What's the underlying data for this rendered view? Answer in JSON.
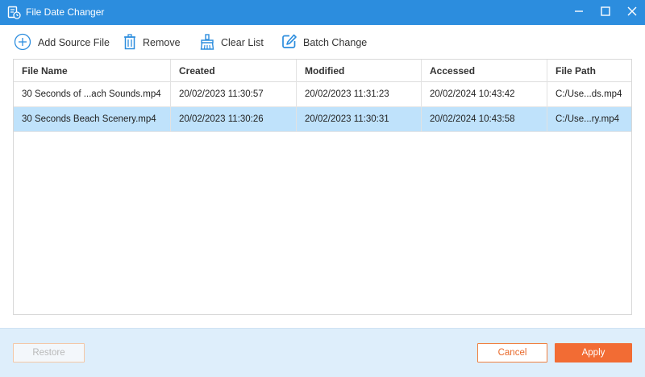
{
  "window": {
    "title": "File Date Changer",
    "accent_color": "#2c8dde"
  },
  "toolbar": {
    "add_label": "Add Source File",
    "remove_label": "Remove",
    "clear_label": "Clear List",
    "batch_label": "Batch Change"
  },
  "table": {
    "columns": [
      "File Name",
      "Created",
      "Modified",
      "Accessed",
      "File Path"
    ],
    "rows": [
      {
        "name": "30 Seconds of ...ach Sounds.mp4",
        "created": "20/02/2023 11:30:57",
        "modified": "20/02/2023 11:31:23",
        "accessed": "20/02/2024 10:43:42",
        "path": "C:/Use...ds.mp4",
        "selected": false
      },
      {
        "name": "30 Seconds Beach Scenery.mp4",
        "created": "20/02/2023 11:30:26",
        "modified": "20/02/2023 11:30:31",
        "accessed": "20/02/2024 10:43:58",
        "path": "C:/Use...ry.mp4",
        "selected": true
      }
    ],
    "selected_row_color": "#bfe2fb"
  },
  "footer": {
    "restore_label": "Restore",
    "cancel_label": "Cancel",
    "apply_label": "Apply",
    "primary_color": "#f26c34"
  }
}
